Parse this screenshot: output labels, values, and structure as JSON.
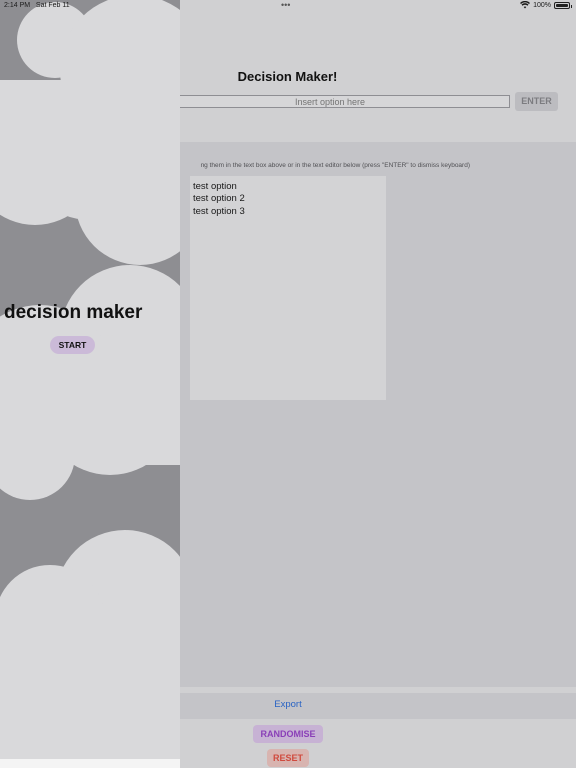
{
  "status_bar": {
    "time": "2:14 PM",
    "date": "Sat Feb 11",
    "dots": "•••",
    "battery": "100%",
    "icons": [
      "wifi-icon",
      "battery-icon"
    ]
  },
  "app": {
    "title": "Decision Maker!",
    "input": {
      "placeholder": "Insert option here",
      "value": ""
    },
    "enter_label": "ENTER",
    "instructions": "ng them in the text box above or in the text editor below (press \"ENTER\" to dismiss keyboard)",
    "options": [
      "test option",
      "test option 2",
      "test option 3"
    ],
    "export_label": "Export",
    "randomise_label": "RANDOMISE",
    "reset_label": "RESET"
  },
  "side_panel": {
    "heading": "decision maker",
    "start_label": "START"
  },
  "colors": {
    "background": "#d0d0d2",
    "panel": "#c4c4c8",
    "side_panel": "#8e8e92",
    "cloud": "#d9d9db",
    "accent_link": "#2a64c4",
    "randomise_text": "#8a3fb8",
    "randomise_bg": "#c7b2d4",
    "reset_text": "#d04a3e",
    "reset_bg": "#d8b4b0",
    "start_bg": "#cbbad8"
  }
}
